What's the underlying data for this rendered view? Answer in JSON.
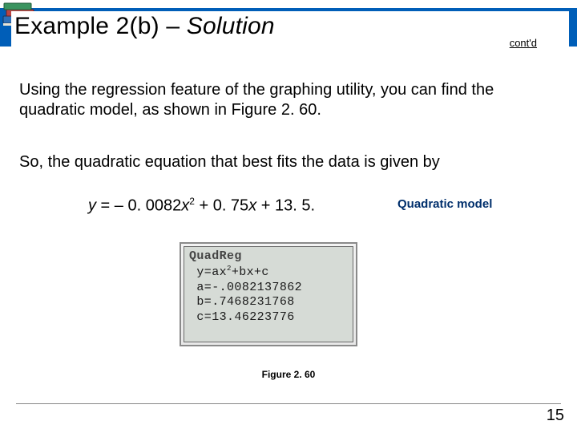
{
  "header": {
    "title_prefix": "Example 2(b) – ",
    "title_solution": "Solution",
    "contd": "cont'd"
  },
  "body": {
    "p1": "Using the regression feature of the graphing utility, you can find the quadratic model, as shown in Figure 2. 60.",
    "p2": "So, the quadratic equation that best fits the data is given by"
  },
  "equation": {
    "lhs": "y",
    "eq": " = ",
    "t1": "– 0. 0082",
    "t1v": "x",
    "t1s": "2",
    "t2": " + 0. 75",
    "t2v": "x",
    "t3": " + 13. 5.",
    "label": "Quadratic model"
  },
  "calc": {
    "header": "QuadReg",
    "line1_pre": "y=ax",
    "line1_sup": "2",
    "line1_post": "+bx+c",
    "line2": "a=-.0082137862",
    "line3": "b=.7468231768",
    "line4": "c=13.46223776"
  },
  "figure_caption": "Figure 2. 60",
  "page_number": "15"
}
